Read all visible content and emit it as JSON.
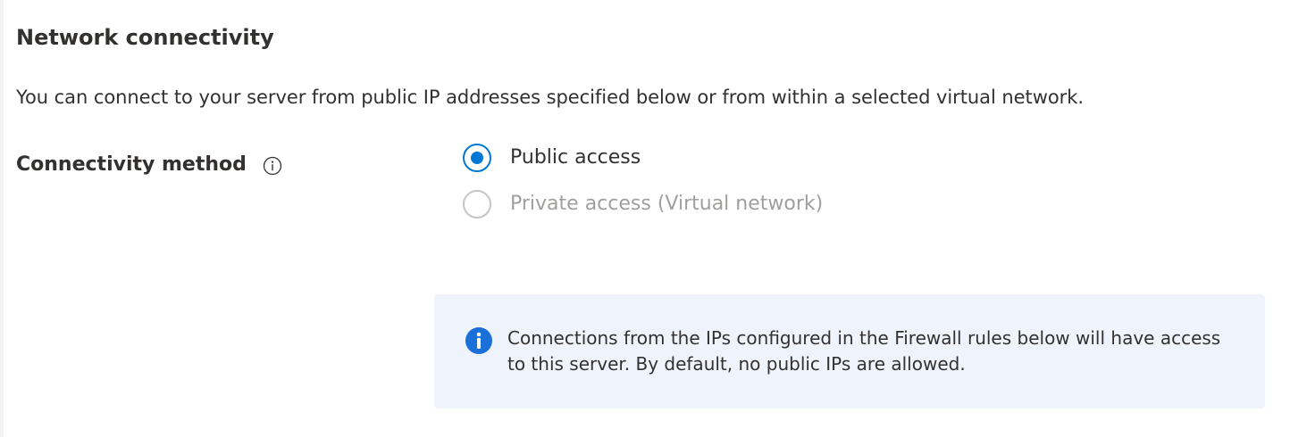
{
  "section": {
    "title": "Network connectivity",
    "description": "You can connect to your server from public IP addresses specified below or from within a selected virtual network."
  },
  "connectivity_method": {
    "label": "Connectivity method",
    "info_icon": "info-circle-icon",
    "options": [
      {
        "label": "Public access",
        "selected": true,
        "disabled": false
      },
      {
        "label": "Private access (Virtual network)",
        "selected": false,
        "disabled": true
      }
    ]
  },
  "info_box": {
    "icon": "info-filled-icon",
    "text": "Connections from the IPs configured in the Firewall rules below will have access to this server. By default, no public IPs are allowed."
  },
  "colors": {
    "accent": "#0078d4",
    "text": "#323130",
    "disabled_text": "#a19f9d",
    "disabled_border": "#c8c6c4",
    "info_background": "#eff4fc",
    "info_icon": "#1b6fd9"
  }
}
